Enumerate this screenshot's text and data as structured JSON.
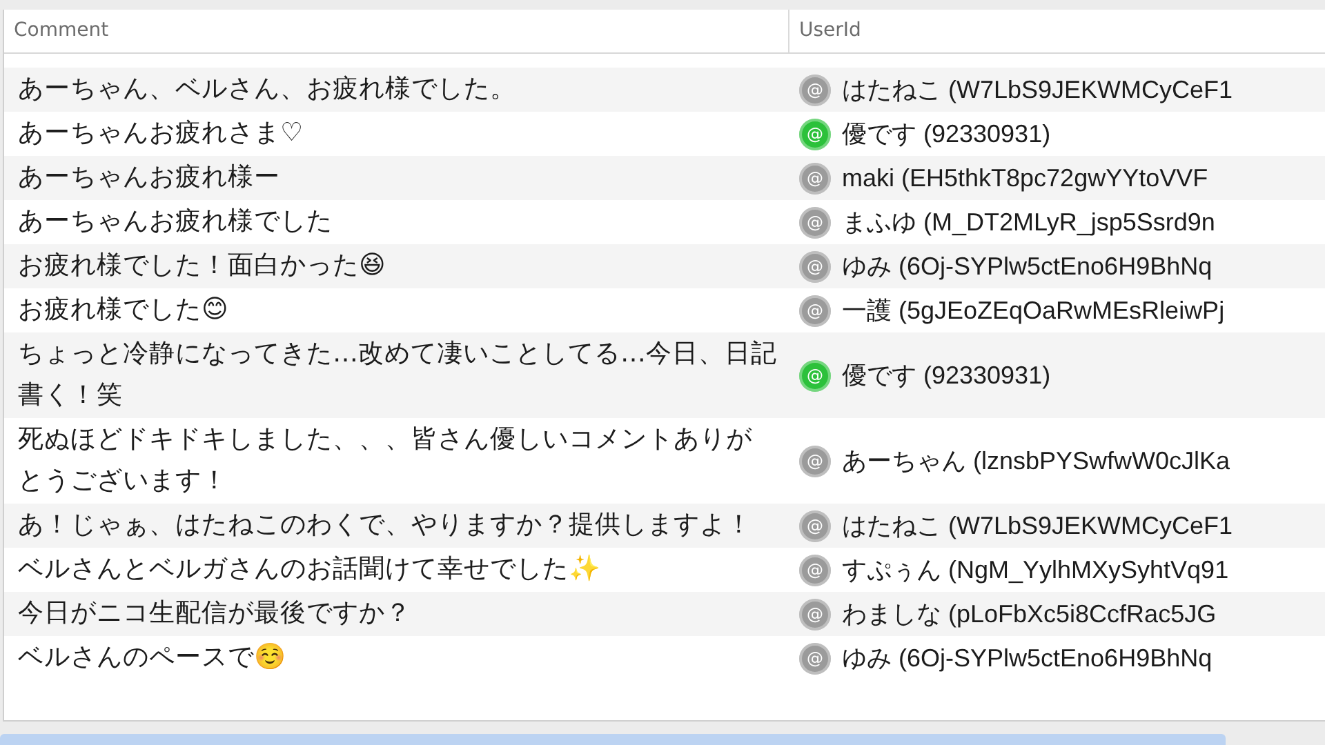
{
  "table": {
    "columns": [
      "Comment",
      "UserId"
    ],
    "rows": [
      {
        "comment": "あーちゃん、ベルさん、お疲れ様でした。",
        "badge": "@",
        "color": "#9b9b9b",
        "user": "はたねこ (W7LbS9JEKWMCyCeF1"
      },
      {
        "comment": "あーちゃんお疲れさま♡",
        "badge": "@",
        "color": "#2cc13b",
        "user": "優です (92330931)"
      },
      {
        "comment": "あーちゃんお疲れ様ー",
        "badge": "@",
        "color": "#9b9b9b",
        "user": "maki (EH5thkT8pc72gwYYtoVVF"
      },
      {
        "comment": "あーちゃんお疲れ様でした",
        "badge": "@",
        "color": "#9b9b9b",
        "user": "まふゆ (M_DT2MLyR_jsp5Ssrd9n"
      },
      {
        "comment": "お疲れ様でした！面白かった😆",
        "badge": "@",
        "color": "#9b9b9b",
        "user": "ゆみ (6Oj-SYPlw5ctEno6H9BhNq"
      },
      {
        "comment": "お疲れ様でした😊",
        "badge": "@",
        "color": "#9b9b9b",
        "user": "一護 (5gJEoZEqOaRwMEsRleiwPj"
      },
      {
        "comment": "ちょっと冷静になってきた…改めて凄いことしてる…今日、日記書く！笑",
        "badge": "@",
        "color": "#2cc13b",
        "user": "優です (92330931)"
      },
      {
        "comment": "死ぬほどドキドキしました、、、皆さん優しいコメントありがとうございます！",
        "badge": "@",
        "color": "#9b9b9b",
        "user": "あーちゃん (lznsbPYSwfwW0cJlKa"
      },
      {
        "comment": "あ！じゃぁ、はたねこのわくで、やりますか？提供しますよ！",
        "badge": "@",
        "color": "#9b9b9b",
        "user": "はたねこ (W7LbS9JEKWMCyCeF1"
      },
      {
        "comment": "ベルさんとベルガさんのお話聞けて幸せでした✨",
        "badge": "@",
        "color": "#9b9b9b",
        "user": "すぷぅん (NgM_YylhMXySyhtVq91"
      },
      {
        "comment": "今日がニコ生配信が最後ですか？",
        "badge": "@",
        "color": "#9b9b9b",
        "user": "わましな (pLoFbXc5i8CcfRac5JG"
      },
      {
        "comment": "ベルさんのペースで☺️",
        "badge": "@",
        "color": "#9b9b9b",
        "user": "ゆみ (6Oj-SYPlw5ctEno6H9BhNq"
      }
    ]
  }
}
